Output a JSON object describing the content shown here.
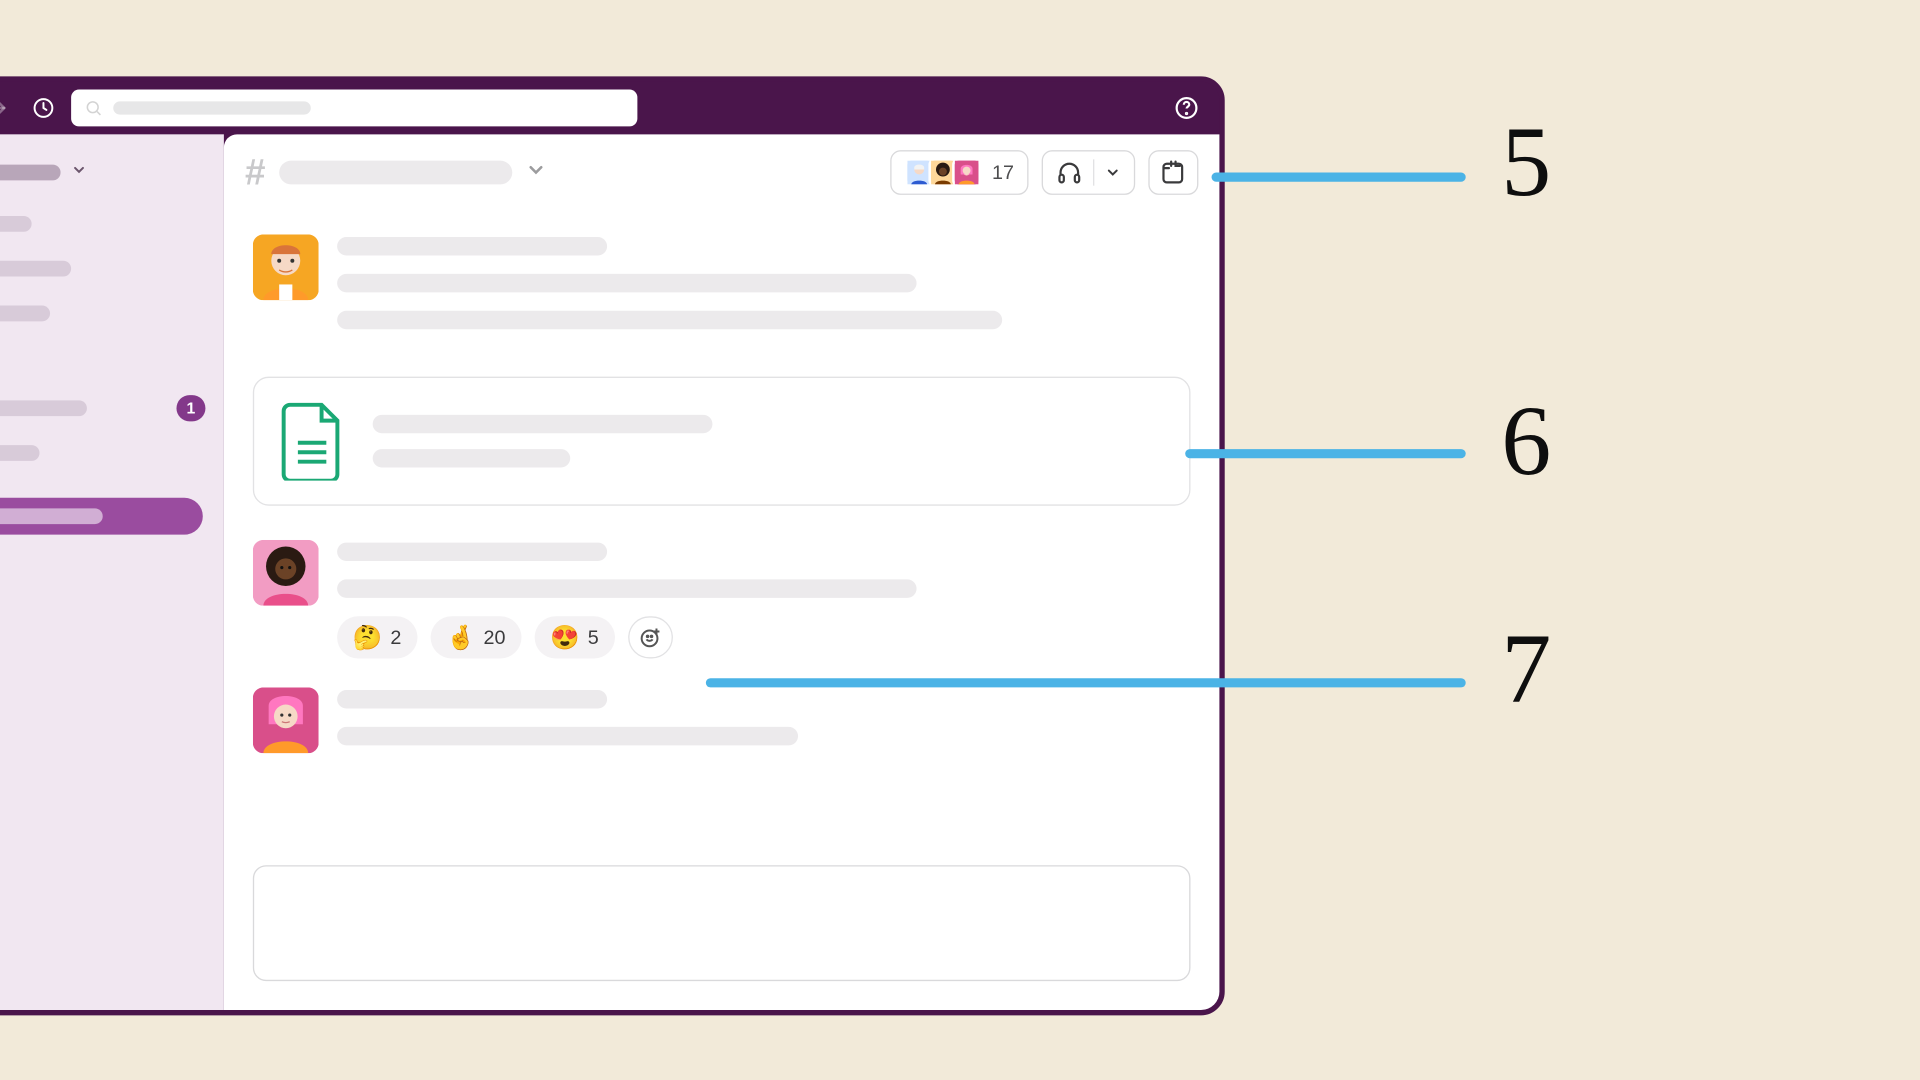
{
  "sidebar": {
    "badge": "1"
  },
  "channel_header": {
    "member_count": "17"
  },
  "reactions": [
    {
      "emoji": "🤔",
      "count": "2"
    },
    {
      "emoji": "🤞",
      "count": "20"
    },
    {
      "emoji": "😍",
      "count": "5"
    }
  ],
  "callouts": {
    "five": "5",
    "six": "6",
    "seven": "7"
  }
}
